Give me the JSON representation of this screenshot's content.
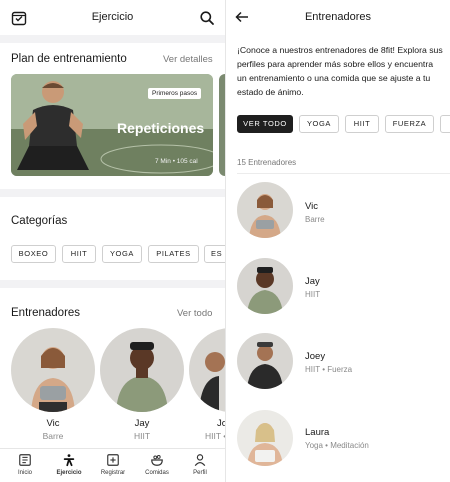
{
  "left": {
    "header": {
      "title": "Ejercicio",
      "icons": [
        "calendar-check-icon",
        "search-icon"
      ]
    },
    "plan": {
      "title": "Plan de entrenamiento",
      "link": "Ver detalles",
      "card": {
        "tag": "Primeros pasos",
        "title": "Repeticiones",
        "meta": "7 Min • 105 cal"
      }
    },
    "categories": {
      "title": "Categorías",
      "chips": [
        "BOXEO",
        "HIIT",
        "YOGA",
        "PILATES",
        "ES"
      ]
    },
    "trainers": {
      "title": "Entrenadores",
      "link": "Ver todo",
      "items": [
        {
          "name": "Vic",
          "specialty": "Barre"
        },
        {
          "name": "Jay",
          "specialty": "HIIT"
        },
        {
          "name": "Jo",
          "specialty": "HIIT • Fu"
        }
      ]
    },
    "tabbar": {
      "items": [
        {
          "label": "Inicio",
          "icon": "home-icon"
        },
        {
          "label": "Ejercicio",
          "icon": "workout-icon",
          "active": true
        },
        {
          "label": "Registrar",
          "icon": "plus-square-icon"
        },
        {
          "label": "Comidas",
          "icon": "meals-icon"
        },
        {
          "label": "Perfil",
          "icon": "profile-icon"
        }
      ]
    }
  },
  "right": {
    "header": {
      "title": "Entrenadores",
      "back_icon": "arrow-left-icon"
    },
    "intro": "¡Conoce a nuestros entrenadores de 8fit! Explora sus perfiles para aprender más sobre ellos y encuentra un entrenamiento o una comida que se ajuste a tu estado de ánimo.",
    "filters": [
      "VER TODO",
      "YOGA",
      "HIIT",
      "FUERZA",
      ""
    ],
    "count": "15 Entrenadores",
    "trainers": [
      {
        "name": "Vic",
        "specialty": "Barre"
      },
      {
        "name": "Jay",
        "specialty": "HIIT"
      },
      {
        "name": "Joey",
        "specialty": "HIIT • Fuerza"
      },
      {
        "name": "Laura",
        "specialty": "Yoga • Meditación"
      }
    ]
  },
  "colors": {
    "accent": "#1f1f1f",
    "muted": "#8a8a8a",
    "band": "#f2f2f4",
    "chip_border": "#cfcfcf"
  }
}
